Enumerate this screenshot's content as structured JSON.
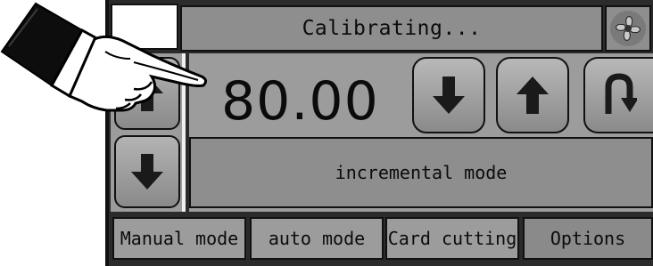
{
  "header": {
    "status_text": "Calibrating...",
    "fan_icon": "fan-icon"
  },
  "display": {
    "value": "80.00"
  },
  "controls": {
    "side_up_icon": "arrow-up-icon",
    "side_down_icon": "arrow-down-icon",
    "decrease_icon": "arrow-down-icon",
    "increase_icon": "arrow-up-icon",
    "return_icon": "u-turn-icon"
  },
  "mode": {
    "label": "incremental mode"
  },
  "tabs": [
    {
      "label": "Manual mode"
    },
    {
      "label": "auto mode"
    },
    {
      "label": "Card cutting"
    },
    {
      "label": "Options"
    }
  ],
  "illustration": {
    "pointer": "pointing-hand-icon"
  }
}
